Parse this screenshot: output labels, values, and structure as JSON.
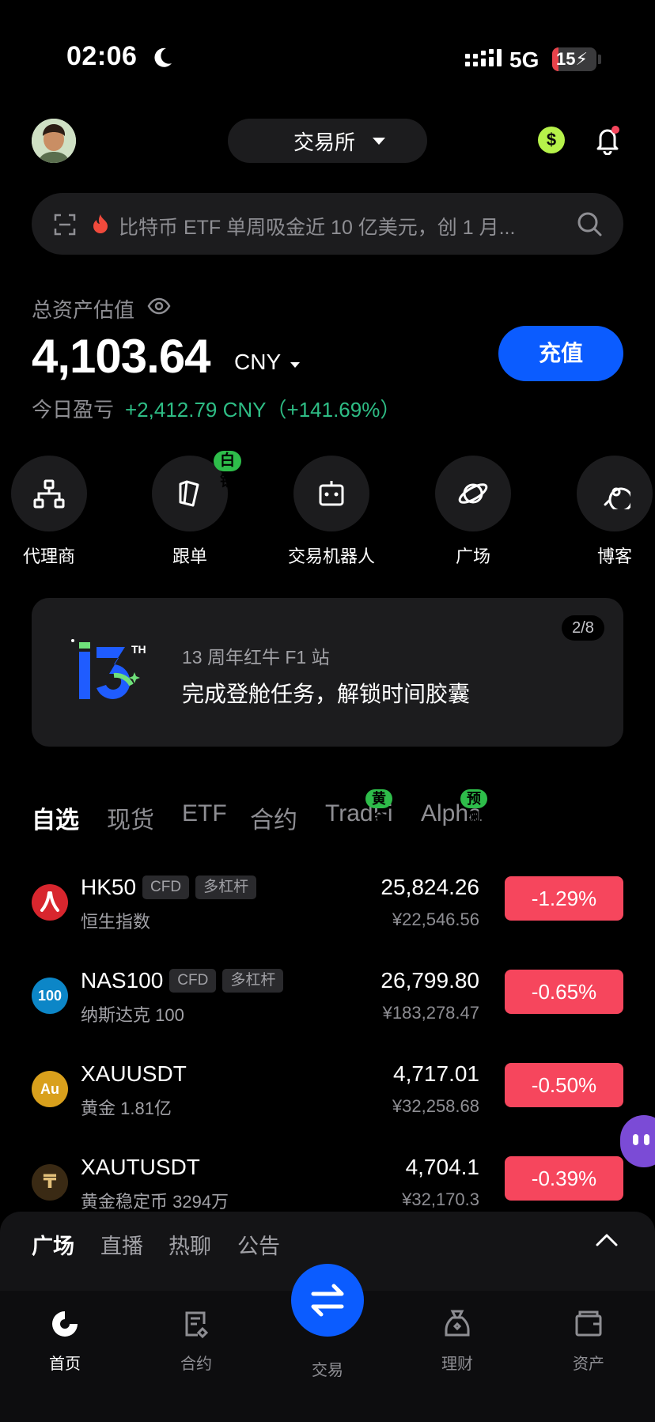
{
  "status_bar": {
    "time": "02:06",
    "network": "5G",
    "battery": "15",
    "battery_level": 0.15
  },
  "header": {
    "exchange_label": "交易所",
    "dollar_symbol": "$"
  },
  "search": {
    "text": "比特币 ETF 单周吸金近 10 亿美元，创 1 月..."
  },
  "assets": {
    "label": "总资产估值",
    "balance": "4,103.64",
    "currency": "CNY",
    "pnl_label": "今日盈亏",
    "pnl_value": "+2,412.79 CNY（+141.69%）",
    "deposit_label": "充值"
  },
  "quick_actions": [
    {
      "label": "代理商",
      "icon": "hierarchy-icon"
    },
    {
      "label": "跟单",
      "icon": "cards-icon",
      "badge": "白银"
    },
    {
      "label": "交易机器人",
      "icon": "robot-icon"
    },
    {
      "label": "广场",
      "icon": "planet-icon"
    },
    {
      "label": "博客",
      "icon": "blog-icon"
    }
  ],
  "banner": {
    "logo_text": "13",
    "logo_sup": "TH",
    "subtitle": "13 周年红牛 F1 站",
    "title": "完成登舱任务，解锁时间胶囊",
    "page": "2/8"
  },
  "market_tabs": [
    {
      "label": "自选",
      "active": true
    },
    {
      "label": "现货"
    },
    {
      "label": "ETF"
    },
    {
      "label": "合约"
    },
    {
      "label": "TradFi",
      "badge": "黄金"
    },
    {
      "label": "Alpha",
      "badge": "预测"
    }
  ],
  "market_rows": [
    {
      "symbol": "HK50",
      "tags": [
        "CFD",
        "多杠杆"
      ],
      "name": "恒生指数",
      "price": "25,824.26",
      "cny": "¥22,546.56",
      "change": "-1.29%",
      "icon_text": "",
      "icon_color": "#d8262e"
    },
    {
      "symbol": "NAS100",
      "tags": [
        "CFD",
        "多杠杆"
      ],
      "name": "纳斯达克 100",
      "price": "26,799.80",
      "cny": "¥183,278.47",
      "change": "-0.65%",
      "icon_text": "100",
      "icon_color": "#0c86c7"
    },
    {
      "symbol": "XAUUSDT",
      "tags": [],
      "name": "黄金 1.81亿",
      "price": "4,717.01",
      "cny": "¥32,258.68",
      "change": "-0.50%",
      "icon_text": "Au",
      "icon_color": "#d9a01c"
    },
    {
      "symbol": "XAUTUSDT",
      "tags": [],
      "name": "黄金稳定币 3294万",
      "price": "4,704.1",
      "cny": "¥32,170.3",
      "change": "-0.39%",
      "icon_text": "₸",
      "icon_color": "#3a2a14"
    }
  ],
  "social_tabs": [
    {
      "label": "广场",
      "active": true
    },
    {
      "label": "直播"
    },
    {
      "label": "热聊"
    },
    {
      "label": "公告"
    }
  ],
  "nav": [
    {
      "label": "首页",
      "icon": "home-icon",
      "active": true
    },
    {
      "label": "合约",
      "icon": "contract-icon"
    },
    {
      "label": "交易",
      "icon": "swap-icon"
    },
    {
      "label": "理财",
      "icon": "money-bag-icon"
    },
    {
      "label": "资产",
      "icon": "wallet-icon"
    }
  ],
  "colors": {
    "accent": "#0b5cff",
    "up": "#2ebd85",
    "down": "#f6465d",
    "badge": "#2ebd4a"
  }
}
